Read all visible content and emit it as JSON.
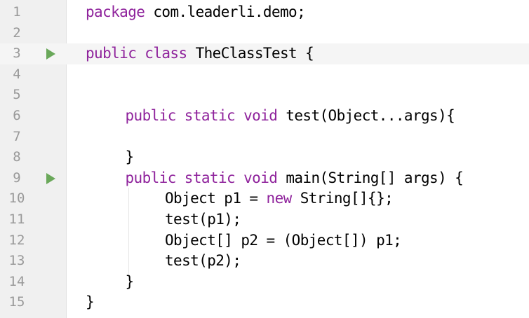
{
  "editor": {
    "colors": {
      "keyword": "#8f239c",
      "text": "#000000",
      "line_number": "#999999",
      "run_icon": "#6aa85a",
      "gutter": "#f0f0f0"
    },
    "lines": [
      {
        "number": "1",
        "run": false,
        "indent": 0,
        "tokens": [
          {
            "t": "package",
            "k": "kw"
          },
          {
            "t": " com.leaderli.demo;",
            "k": "plain"
          }
        ]
      },
      {
        "number": "2",
        "run": false,
        "indent": 0,
        "tokens": []
      },
      {
        "number": "3",
        "run": true,
        "indent": 0,
        "current": true,
        "tokens": [
          {
            "t": "public class",
            "k": "kw"
          },
          {
            "t": " TheClassTest {",
            "k": "plain"
          }
        ]
      },
      {
        "number": "4",
        "run": false,
        "indent": 0,
        "tokens": []
      },
      {
        "number": "5",
        "run": false,
        "indent": 0,
        "tokens": []
      },
      {
        "number": "6",
        "run": false,
        "indent": 1,
        "tokens": [
          {
            "t": "public static void",
            "k": "kw"
          },
          {
            "t": " test(Object...args){",
            "k": "plain"
          }
        ]
      },
      {
        "number": "7",
        "run": false,
        "indent": 0,
        "tokens": []
      },
      {
        "number": "8",
        "run": false,
        "indent": 1,
        "tokens": [
          {
            "t": "}",
            "k": "plain"
          }
        ]
      },
      {
        "number": "9",
        "run": true,
        "indent": 1,
        "tokens": [
          {
            "t": "public static void",
            "k": "kw"
          },
          {
            "t": " main(String[] args) {",
            "k": "plain"
          }
        ]
      },
      {
        "number": "10",
        "run": false,
        "indent": 2,
        "tokens": [
          {
            "t": "Object p1 = ",
            "k": "plain"
          },
          {
            "t": "new",
            "k": "kw"
          },
          {
            "t": " String[]{};",
            "k": "plain"
          }
        ]
      },
      {
        "number": "11",
        "run": false,
        "indent": 2,
        "tokens": [
          {
            "t": "test(p1);",
            "k": "plain"
          }
        ]
      },
      {
        "number": "12",
        "run": false,
        "indent": 2,
        "tokens": [
          {
            "t": "Object[] p2 = (Object[]) p1;",
            "k": "plain"
          }
        ]
      },
      {
        "number": "13",
        "run": false,
        "indent": 2,
        "tokens": [
          {
            "t": "test(p2);",
            "k": "plain"
          }
        ]
      },
      {
        "number": "14",
        "run": false,
        "indent": 1,
        "tokens": [
          {
            "t": "}",
            "k": "plain"
          }
        ]
      },
      {
        "number": "15",
        "run": false,
        "indent": 0,
        "tokens": [
          {
            "t": "}",
            "k": "plain"
          }
        ]
      }
    ]
  }
}
